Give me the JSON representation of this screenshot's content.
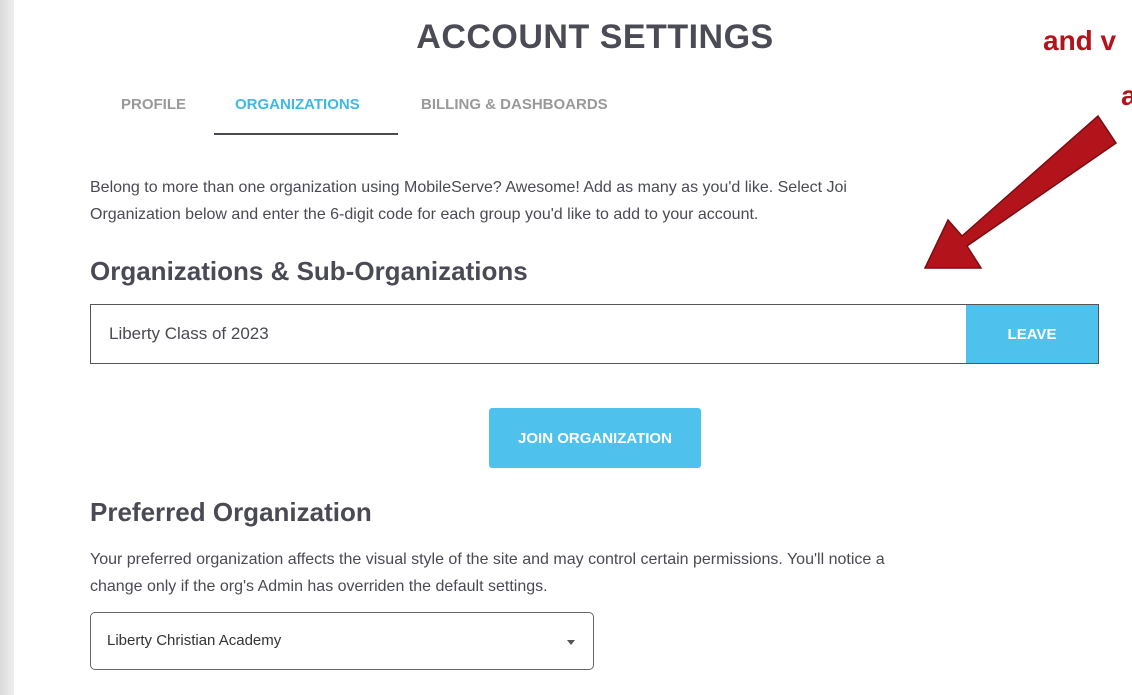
{
  "header": {
    "title": "ACCOUNT SETTINGS"
  },
  "annotation": {
    "line1": "and v",
    "line2": "a",
    "color": "#b3141c"
  },
  "tabs": [
    {
      "label": "PROFILE",
      "active": false
    },
    {
      "label": "ORGANIZATIONS",
      "active": true
    },
    {
      "label": "BILLING & DASHBOARDS",
      "active": false
    }
  ],
  "intro": {
    "line1": "Belong to more than one organization using MobileServe? Awesome! Add as many as you'd like. Select Joi",
    "line2": "Organization below and enter the 6-digit code for each group you'd like to add to your account."
  },
  "organizations": {
    "heading": "Organizations & Sub-Organizations",
    "items": [
      {
        "name": "Liberty Class of 2023",
        "action": "LEAVE"
      }
    ],
    "join_label": "JOIN ORGANIZATION"
  },
  "preferred": {
    "heading": "Preferred Organization",
    "description_line1": "Your preferred organization affects the visual style of the site and may control certain permissions. You'll notice a",
    "description_line2": "change only if the org's Admin has overriden the default settings.",
    "selected": "Liberty Christian Academy"
  },
  "colors": {
    "accent": "#4ec2ec",
    "text": "#4a4a55",
    "arrow": "#b3141c"
  }
}
